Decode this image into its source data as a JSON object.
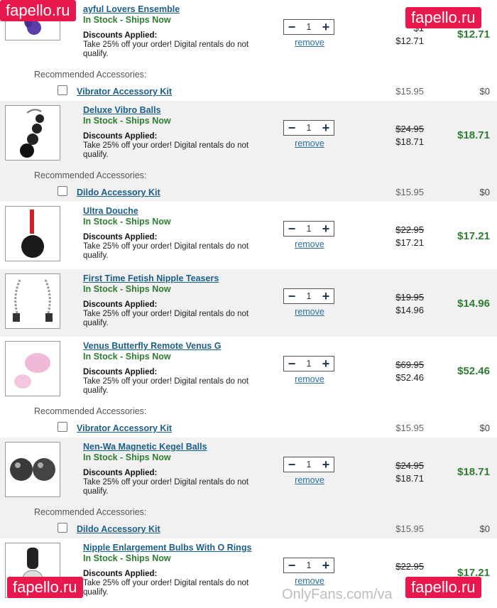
{
  "watermark": "fapello.ru",
  "footer_watermark": "OnlyFans.com/va",
  "rec_label": "Recommended Accessories:",
  "qty_value": "1",
  "remove_label": "remove",
  "discount_title": "Discounts Applied:",
  "discount_text": "Take 25% off your order! Digital rentals do not qualify.",
  "stock_text": "In Stock - Ships Now",
  "items": [
    {
      "name": "ayful Lovers Ensemble",
      "old_price": "$1",
      "price": "$12.71",
      "total": "$12.71"
    },
    {
      "name": "Deluxe Vibro Balls",
      "old_price": "$24.95",
      "price": "$18.71",
      "total": "$18.71"
    },
    {
      "name": "Ultra Douche",
      "old_price": "$22.95",
      "price": "$17.21",
      "total": "$17.21"
    },
    {
      "name": "First Time Fetish Nipple Teasers",
      "old_price": "$19.95",
      "price": "$14.96",
      "total": "$14.96"
    },
    {
      "name": "Venus Butterfly Remote Venus G",
      "old_price": "$69.95",
      "price": "$52.46",
      "total": "$52.46"
    },
    {
      "name": "Nen-Wa Magnetic Kegel Balls",
      "old_price": "$24.95",
      "price": "$18.71",
      "total": "$18.71"
    },
    {
      "name": "Nipple Enlargement Bulbs With O Rings",
      "old_price": "$22.95",
      "price": "",
      "total": "$17.21"
    }
  ],
  "accessories": [
    {
      "name": "Vibrator Accessory Kit",
      "price": "$15.95",
      "total": "$0"
    },
    {
      "name": "Dildo Accessory Kit",
      "price": "$15.95",
      "total": "$0"
    },
    {
      "name": "Vibrator Accessory Kit",
      "price": "$15.95",
      "total": "$0"
    },
    {
      "name": "Dildo Accessory Kit",
      "price": "$15.95",
      "total": "$0"
    }
  ],
  "colors": {
    "link": "#1a5f8a",
    "stock": "#2f7d32",
    "watermark_bg": "#e8184d",
    "row_shade": "#f1f1f1"
  }
}
